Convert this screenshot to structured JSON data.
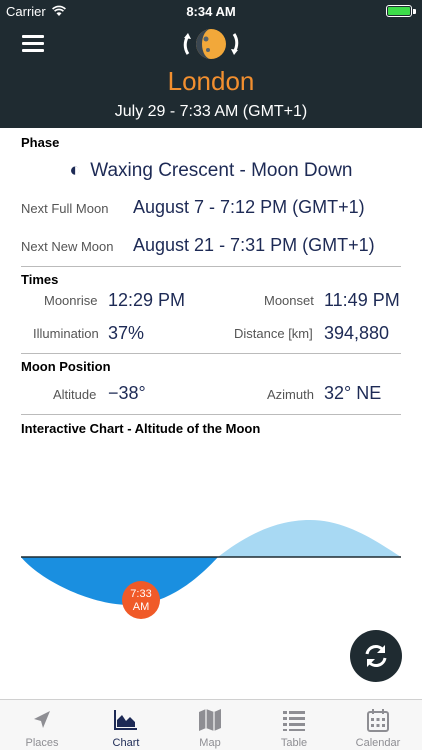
{
  "status_bar": {
    "carrier": "Carrier",
    "time": "8:34 AM"
  },
  "header": {
    "city": "London",
    "datetime": "July 29 - 7:33 AM (GMT+1)"
  },
  "phase": {
    "section_title": "Phase",
    "glyph": "◐",
    "phase_text": "Waxing Crescent - Moon Down",
    "next_full_label": "Next Full Moon",
    "next_full_value": "August 7 - 7:12 PM (GMT+1)",
    "next_new_label": "Next New Moon",
    "next_new_value": "August 21 - 7:31 PM (GMT+1)"
  },
  "times": {
    "section_title": "Times",
    "moonrise_label": "Moonrise",
    "moonrise_value": "12:29 PM",
    "moonset_label": "Moonset",
    "moonset_value": "11:49 PM",
    "illumination_label": "Illumination",
    "illumination_value": "37%",
    "distance_label": "Distance [km]",
    "distance_value": "394,880"
  },
  "position": {
    "section_title": "Moon Position",
    "altitude_label": "Altitude",
    "altitude_value": "−38°",
    "azimuth_label": "Azimuth",
    "azimuth_value": "32° NE"
  },
  "chart": {
    "section_title": "Interactive Chart - Altitude of the Moon",
    "marker_time": "7:33",
    "marker_ampm": "AM",
    "colors": {
      "below_horizon": "#1a8fe0",
      "above_horizon": "#a8d9f3",
      "marker": "#f05a28"
    }
  },
  "chart_data": {
    "type": "area",
    "title": "Interactive Chart - Altitude of the Moon",
    "xlabel": "",
    "ylabel": "",
    "marker": {
      "label": "7:33 AM",
      "altitude_deg": -38
    }
  },
  "tabs": [
    {
      "label": "Places",
      "icon": "location-arrow-icon",
      "active": false
    },
    {
      "label": "Chart",
      "icon": "area-chart-icon",
      "active": true
    },
    {
      "label": "Map",
      "icon": "map-icon",
      "active": false
    },
    {
      "label": "Table",
      "icon": "table-list-icon",
      "active": false
    },
    {
      "label": "Calendar",
      "icon": "calendar-icon",
      "active": false
    }
  ],
  "colors": {
    "header_bg": "#1f2b31",
    "city_orange": "#f28f2f",
    "value_navy": "#1d2a55"
  }
}
